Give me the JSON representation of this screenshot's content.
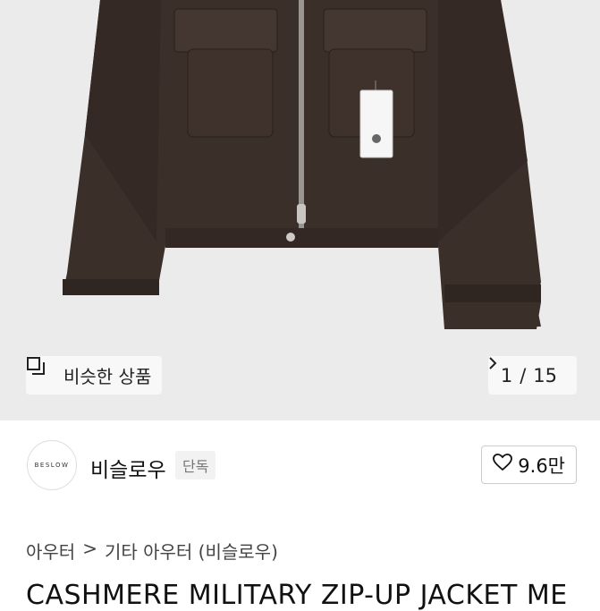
{
  "gallery": {
    "similar_label": "비슷한 상품",
    "page_current": "1",
    "page_sep": "/",
    "page_total": "15",
    "colors": {
      "background": "#ebebeb",
      "jacket": "#3b2f2a"
    }
  },
  "seller": {
    "logo_text": "BESLOW",
    "name": "비슬로우",
    "badge": "단독",
    "likes": "9.6만"
  },
  "breadcrumb": {
    "level1": "아우터",
    "separator": ">",
    "level2": "기타 아우터 (비슬로우)"
  },
  "product": {
    "title": "CASHMERE MILITARY ZIP-UP JACKET ME"
  }
}
